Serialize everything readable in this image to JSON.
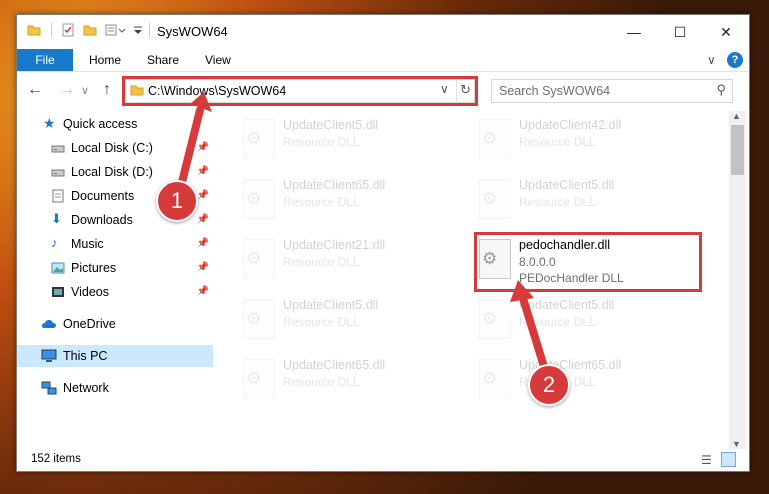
{
  "window": {
    "title": "SysWOW64"
  },
  "ribbon": {
    "tabs": [
      "File",
      "Home",
      "Share",
      "View"
    ]
  },
  "address": {
    "path": "C:\\Windows\\SysWOW64",
    "search_placeholder": "Search SysWOW64"
  },
  "nav": [
    {
      "label": "Quick access",
      "icon": "star-icon"
    },
    {
      "label": "Local Disk (C:)",
      "icon": "drive-icon"
    },
    {
      "label": "Local Disk (D:)",
      "icon": "drive-icon"
    },
    {
      "label": "Documents",
      "icon": "documents-icon"
    },
    {
      "label": "Downloads",
      "icon": "download-icon"
    },
    {
      "label": "Music",
      "icon": "music-icon"
    },
    {
      "label": "Pictures",
      "icon": "pictures-icon"
    },
    {
      "label": "Videos",
      "icon": "videos-icon"
    },
    {
      "label": "OneDrive",
      "icon": "cloud-icon"
    },
    {
      "label": "This PC",
      "icon": "computer-icon",
      "selected": true
    },
    {
      "label": "Network",
      "icon": "network-icon"
    }
  ],
  "files": [
    {
      "name": "UpdateClient5.dll",
      "line2": "Resource DLL",
      "line3": ""
    },
    {
      "name": "UpdateClient42.dll",
      "line2": "Resource DLL",
      "line3": ""
    },
    {
      "name": "UpdateClient65.dll",
      "line2": "Resource DLL",
      "line3": ""
    },
    {
      "name": "UpdateClient5.dll",
      "line2": "Resource DLL",
      "line3": ""
    },
    {
      "name": "UpdateClient21.dll",
      "line2": "Resource DLL",
      "line3": ""
    },
    {
      "name": "pedochandler.dll",
      "line2": "8.0.0.0",
      "line3": "PEDocHandler DLL",
      "highlight": true
    },
    {
      "name": "UpdateClient5.dll",
      "line2": "Resource DLL",
      "line3": ""
    },
    {
      "name": "UpdateClient5.dll",
      "line2": "Resource DLL",
      "line3": ""
    },
    {
      "name": "UpdateClient65.dll",
      "line2": "Resource DLL",
      "line3": ""
    },
    {
      "name": "UpdateClient65.dll",
      "line2": "Resource DLL",
      "line3": ""
    }
  ],
  "status": {
    "count": "152 items"
  },
  "annotations": {
    "step1": "1",
    "step2": "2"
  },
  "colors": {
    "accent": "#1979ca",
    "highlight": "#d63a3a"
  }
}
